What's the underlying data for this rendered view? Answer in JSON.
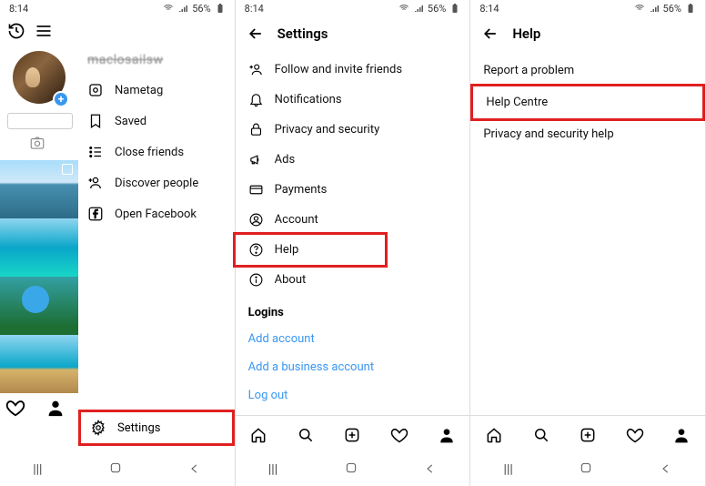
{
  "status": {
    "time": "8:14",
    "battery": "56%"
  },
  "panel1": {
    "username": "maclosailsw",
    "menu": {
      "nametag": "Nametag",
      "saved": "Saved",
      "close_friends": "Close friends",
      "discover": "Discover people",
      "facebook": "Open Facebook"
    },
    "settings": "Settings"
  },
  "panel2": {
    "title": "Settings",
    "items": {
      "follow": "Follow and invite friends",
      "notifications": "Notifications",
      "privacy": "Privacy and security",
      "ads": "Ads",
      "payments": "Payments",
      "account": "Account",
      "help": "Help",
      "about": "About"
    },
    "logins_label": "Logins",
    "add_account": "Add account",
    "add_business": "Add a business account",
    "logout": "Log out"
  },
  "panel3": {
    "title": "Help",
    "report": "Report a problem",
    "help_centre": "Help Centre",
    "privacy_help": "Privacy and security help"
  }
}
